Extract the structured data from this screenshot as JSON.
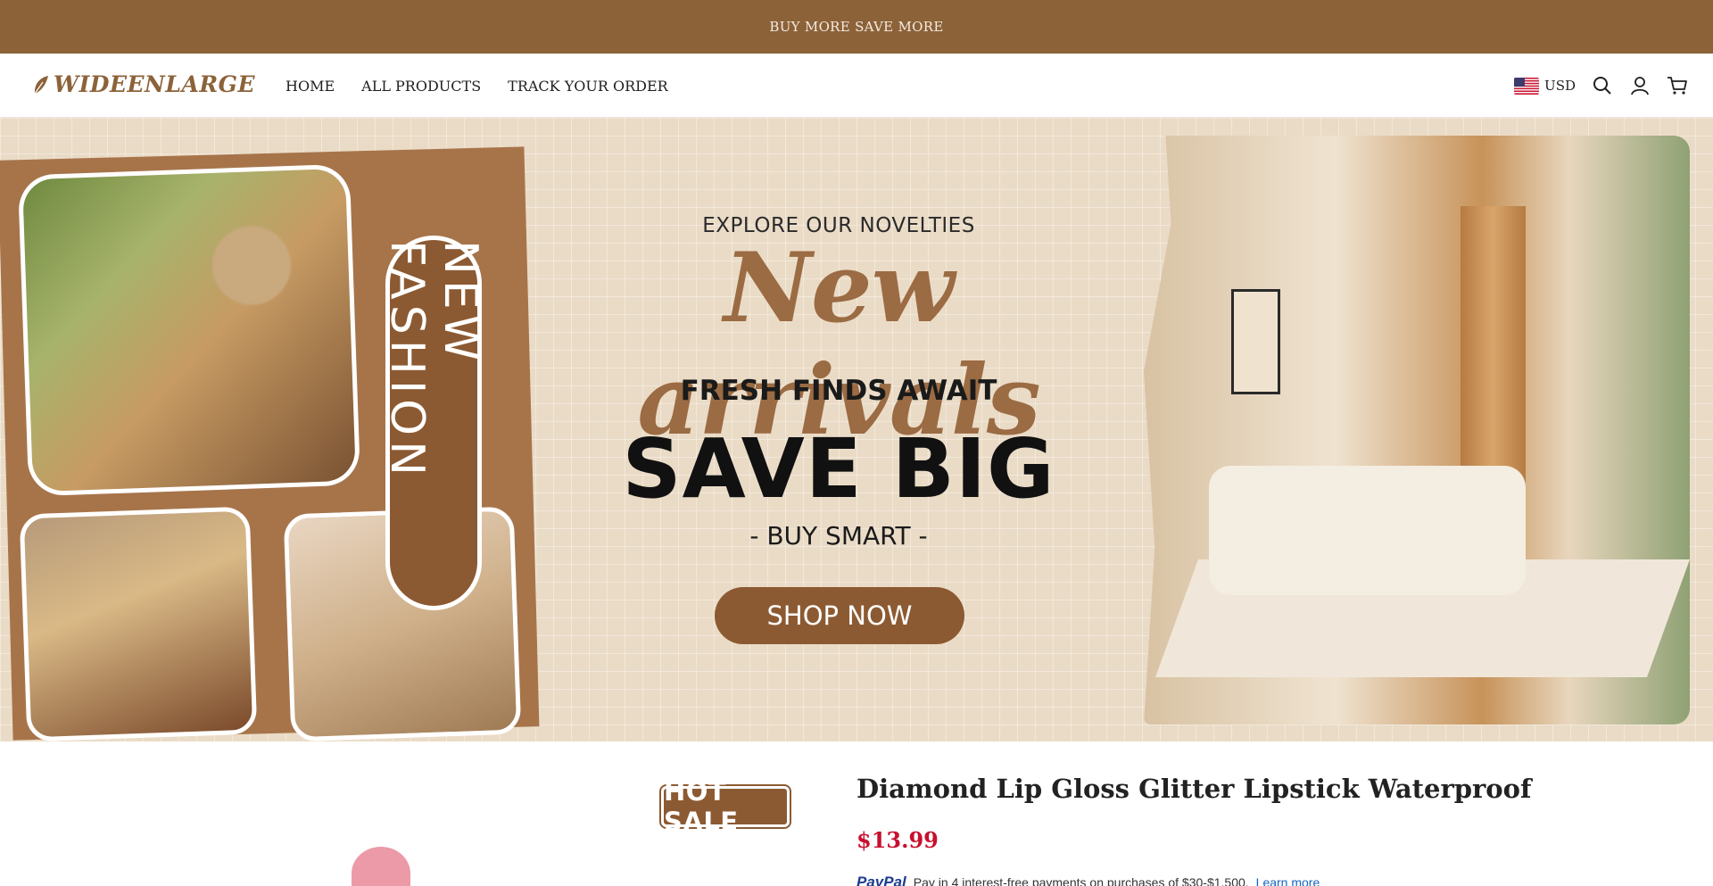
{
  "announcement": {
    "text": "BUY MORE SAVE MORE"
  },
  "header": {
    "logo_text": "WIDEENLARGE",
    "nav": [
      "HOME",
      "ALL PRODUCTS",
      "TRACK YOUR ORDER"
    ],
    "currency": "USD"
  },
  "hero": {
    "side_label": "NEW FASHION",
    "explore": "EXPLORE OUR NOVELTIES",
    "headline": "New arrivals",
    "fresh": "FRESH FINDS AWAIT",
    "save_big": "SAVE BIG",
    "buy_smart": "-  BUY SMART -",
    "cta": "SHOP NOW"
  },
  "product": {
    "badge": "HOT SALE",
    "title": "Diamond Lip Gloss Glitter Lipstick Waterproof",
    "price": "$13.99",
    "paypal_brand": "PayPal",
    "paypal_text": "Pay in 4 interest-free payments on purchases of $30-$1,500.",
    "paypal_link": "Learn more"
  },
  "colors": {
    "brand_brown": "#8c6239",
    "accent_brown": "#8c5a32",
    "price_red": "#c8102e"
  }
}
